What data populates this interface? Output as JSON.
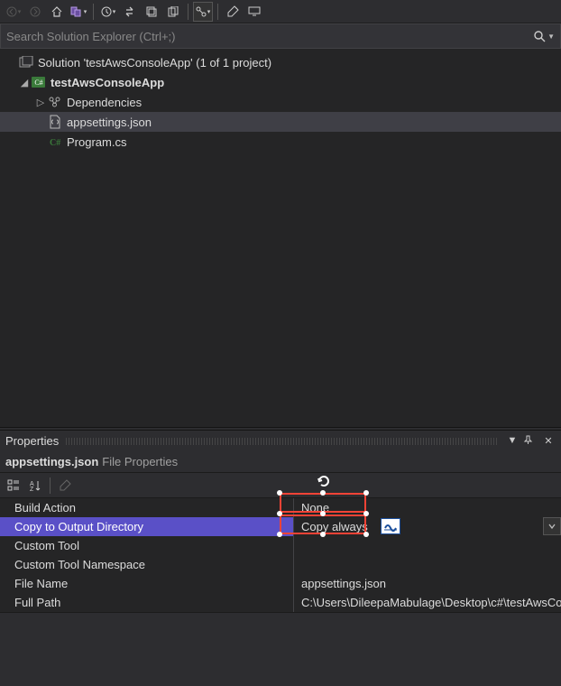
{
  "toolbar": {
    "back_icon": "←",
    "forward_icon": "→"
  },
  "search": {
    "placeholder": "Search Solution Explorer (Ctrl+;)"
  },
  "solution": {
    "root_label": "Solution 'testAwsConsoleApp' (1 of 1 project)",
    "project_label": "testAwsConsoleApp",
    "deps_label": "Dependencies",
    "appsettings_label": "appsettings.json",
    "program_label": "Program.cs"
  },
  "props": {
    "panel_title": "Properties",
    "object_name": "appsettings.json",
    "object_type": "File Properties",
    "rows": {
      "build_action_name": "Build Action",
      "build_action_value": "None",
      "copy_name": "Copy to Output Directory",
      "copy_value": "Copy always",
      "custom_tool_name": "Custom Tool",
      "custom_tool_value": "",
      "custom_tool_ns_name": "Custom Tool Namespace",
      "custom_tool_ns_value": "",
      "file_name_name": "File Name",
      "file_name_value": "appsettings.json",
      "full_path_name": "Full Path",
      "full_path_value": "C:\\Users\\DileepaMabulage\\Desktop\\c#\\testAwsConsoleApp"
    }
  }
}
